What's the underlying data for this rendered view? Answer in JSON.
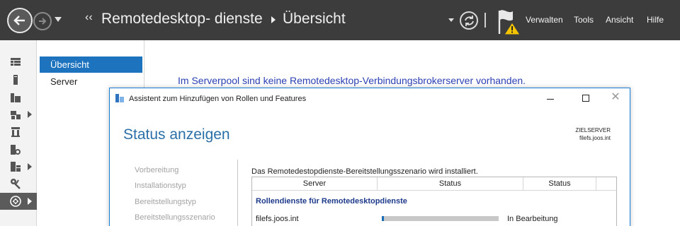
{
  "breadcrumb": {
    "lead": "‹‹",
    "items": [
      "Remotedesktop- dienste",
      "Übersicht"
    ]
  },
  "menu": [
    {
      "label": "Verwalten"
    },
    {
      "label": "Tools"
    },
    {
      "label": "Ansicht"
    },
    {
      "label": "Hilfe"
    }
  ],
  "nav": {
    "items": [
      {
        "label": "Übersicht",
        "selected": true
      },
      {
        "label": "Server",
        "selected": false
      }
    ]
  },
  "rail": {
    "items": [
      {
        "icon": "dashboard-icon",
        "has_arrow": false,
        "active": false
      },
      {
        "icon": "local-server-icon",
        "has_arrow": false,
        "active": false
      },
      {
        "icon": "all-servers-icon",
        "has_arrow": false,
        "active": false
      },
      {
        "icon": "file-storage-icon",
        "has_arrow": true,
        "active": false
      },
      {
        "icon": "iis-icon",
        "has_arrow": false,
        "active": false
      },
      {
        "icon": "remote-access-icon",
        "has_arrow": false,
        "active": false
      },
      {
        "icon": "wsus-icon",
        "has_arrow": true,
        "active": false
      },
      {
        "icon": "tools-icon",
        "has_arrow": false,
        "active": false
      },
      {
        "icon": "remote-desktop-services-icon",
        "has_arrow": true,
        "active": true
      }
    ]
  },
  "main": {
    "message": "Im Serverpool sind keine Remotedesktop-Verbindungsbrokerserver vorhanden."
  },
  "dialog": {
    "title": "Assistent zum Hinzufügen von Rollen und Features",
    "heading": "Status anzeigen",
    "target_label": "ZIELSERVER",
    "target_value": "filefs.joos.int",
    "steps": [
      "Vorbereitung",
      "Installationstyp",
      "Bereitstellungstyp",
      "Bereitstellungsszenario"
    ],
    "install_message": "Das Remotedestopdienste-Bereitstellungsszenario wird installiert.",
    "table": {
      "columns": [
        "Server",
        "Status",
        "Status"
      ],
      "group": "Rollendienste für Remotedesktopdienste",
      "rows": [
        {
          "server": "filefs.joos.int",
          "progress": 0.02,
          "status": "In Bearbeitung"
        }
      ]
    }
  },
  "colors": {
    "topbar": "#3c3c3c",
    "accent": "#1e73be",
    "progress": "#1b6bb5",
    "heading": "#2b6fa8",
    "warning": "#f5c400"
  }
}
